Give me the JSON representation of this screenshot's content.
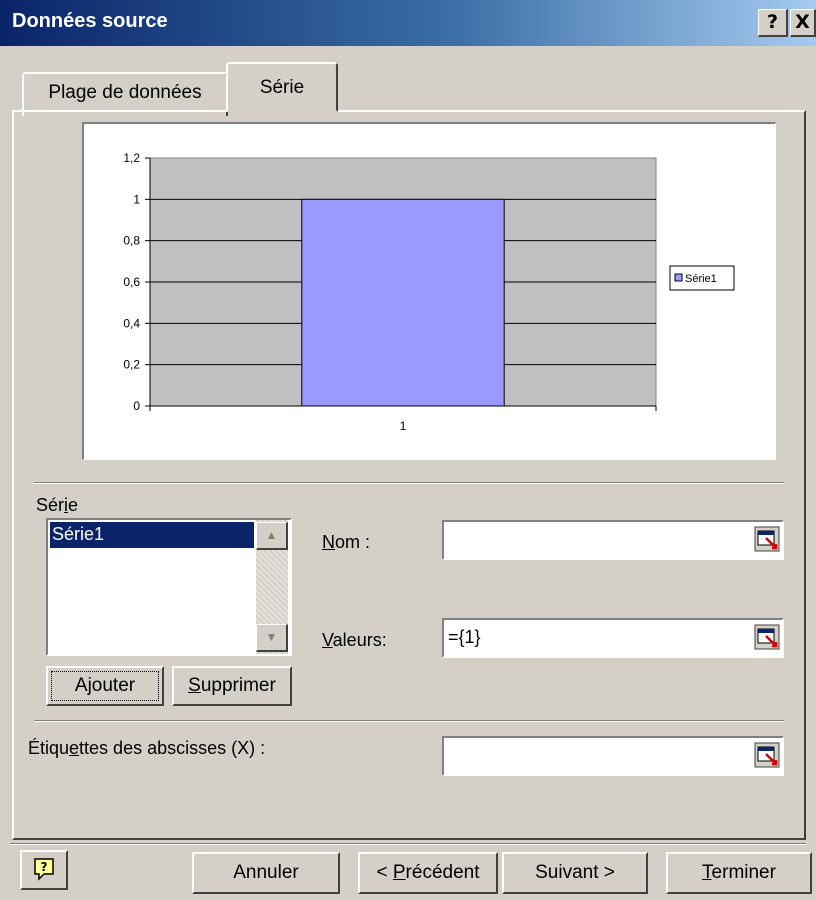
{
  "window": {
    "title": "Données source",
    "help_glyph": "?",
    "close_glyph": "X"
  },
  "tabs": [
    {
      "label": "Plage de données",
      "active": false
    },
    {
      "label": "Série",
      "active": true
    }
  ],
  "chart_data": {
    "type": "bar",
    "categories": [
      "1"
    ],
    "series": [
      {
        "name": "Série1",
        "values": [
          1
        ]
      }
    ],
    "ylim": [
      0,
      1.2
    ],
    "yticks": [
      "0",
      "0,2",
      "0,4",
      "0,6",
      "0,8",
      "1",
      "1,2"
    ],
    "grid": true,
    "legend": "right",
    "colors": {
      "bar": "#9999ff",
      "plot_bg": "#c0c0c0"
    }
  },
  "series_section": {
    "label_pre": "Sér",
    "label_ul": "i",
    "label_post": "e",
    "items": [
      "Série1"
    ],
    "selected": "Série1"
  },
  "fields": {
    "name": {
      "label_ul": "N",
      "label_post": "om :",
      "value": ""
    },
    "values": {
      "label_ul": "V",
      "label_post": "aleurs:",
      "value": "={1}"
    },
    "xlabels": {
      "label_pre": "Étiqu",
      "label_ul": "e",
      "label_post": "ttes des abscisses (X) :",
      "value": ""
    }
  },
  "buttons": {
    "add": {
      "pre": "A",
      "ul": "j",
      "post": "outer"
    },
    "remove": {
      "pre": "",
      "ul": "S",
      "post": "upprimer"
    },
    "cancel": "Annuler",
    "back": {
      "pre": "< ",
      "ul": "P",
      "post": "récédent"
    },
    "next": "Suivant >",
    "finish": {
      "pre": "",
      "ul": "T",
      "post": "erminer"
    }
  }
}
